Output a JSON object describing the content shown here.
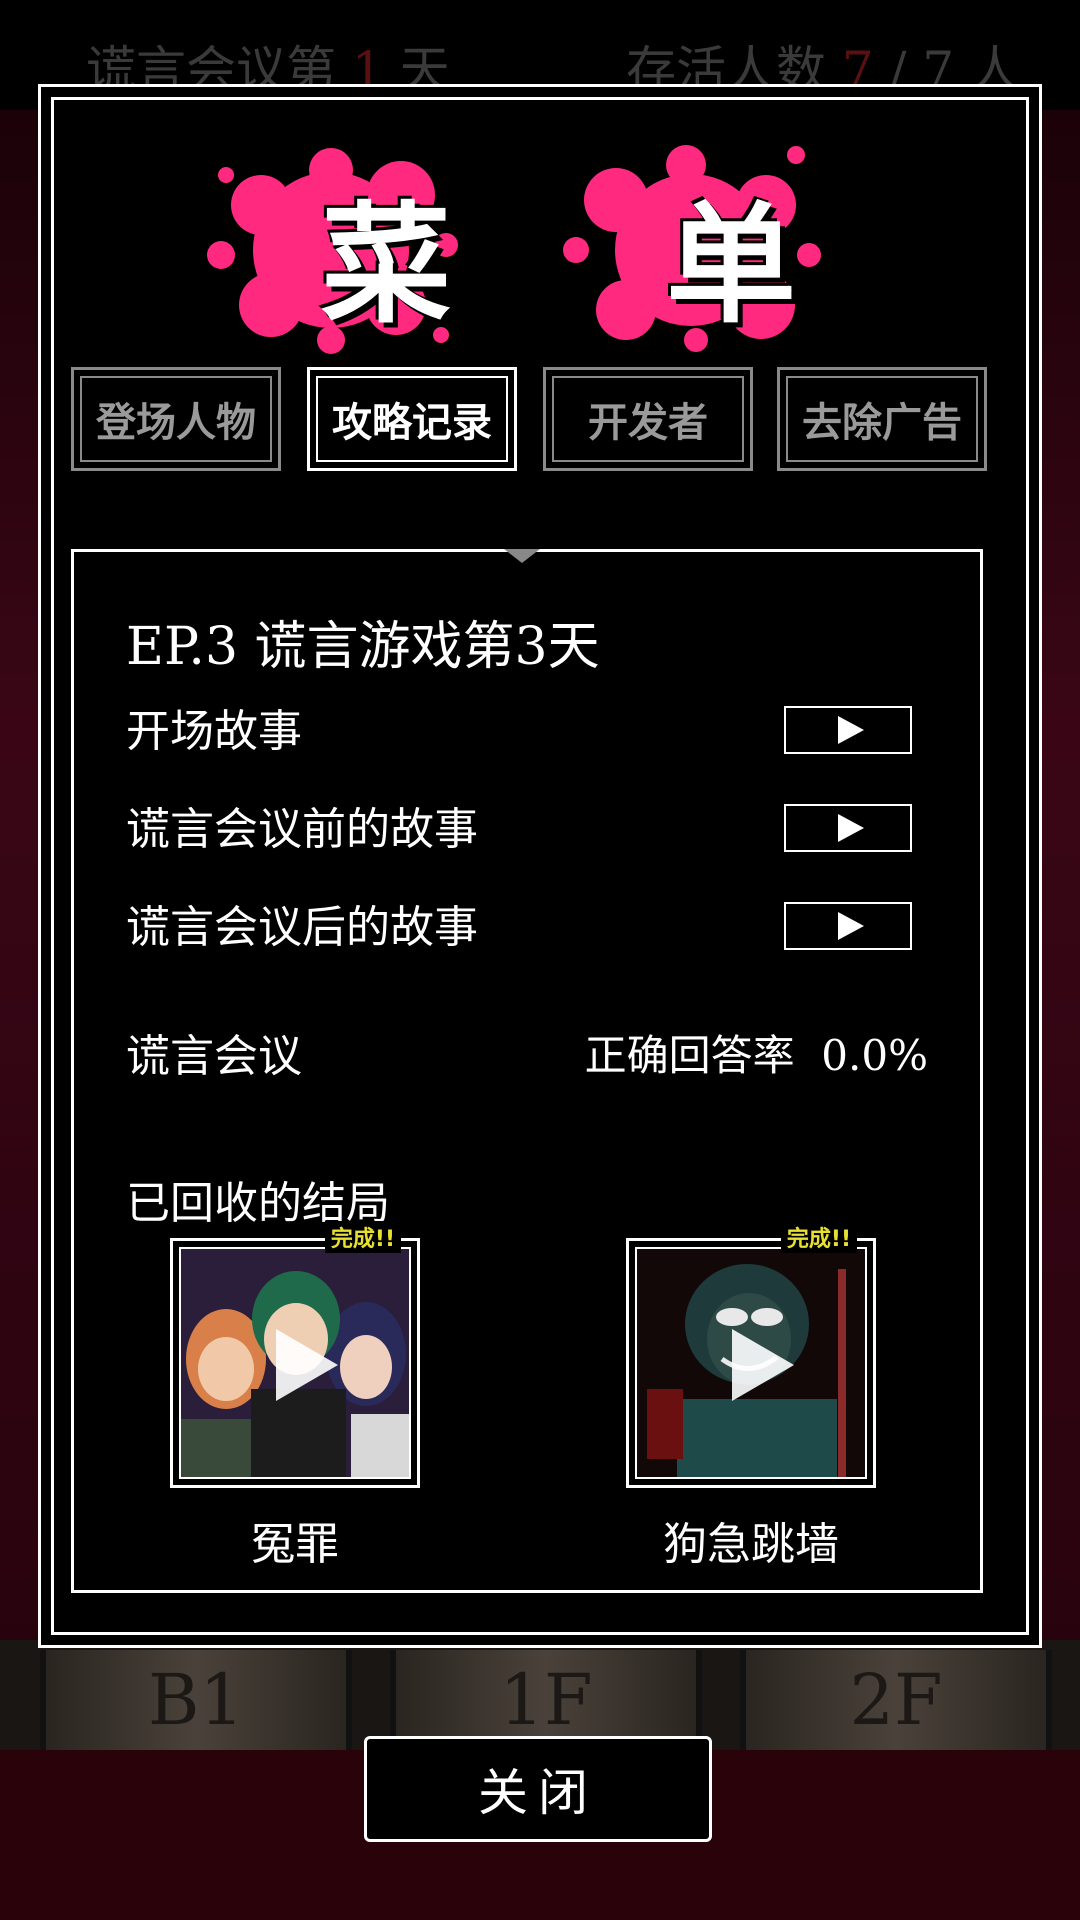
{
  "background": {
    "meeting_day": "谎言会议第",
    "day_number": "1",
    "day_unit": "天",
    "survivors_label": "存活人数",
    "survivors_current": "7",
    "survivors_sep": "/",
    "survivors_total": "7",
    "survivors_unit": "人",
    "floors": [
      "B1",
      "1F",
      "2F"
    ]
  },
  "menu": {
    "title_chars": [
      "菜",
      "单"
    ],
    "splat_color": "#ff2a7f",
    "tabs": [
      {
        "label": "登场人物",
        "active": false
      },
      {
        "label": "攻略记录",
        "active": true
      },
      {
        "label": "开发者",
        "active": false
      },
      {
        "label": "去除广告",
        "active": false
      }
    ]
  },
  "record": {
    "episode_title": "EP.3  谎言游戏第3天",
    "stories": [
      {
        "label": "开场故事"
      },
      {
        "label": "谎言会议前的故事"
      },
      {
        "label": "谎言会议后的故事"
      }
    ],
    "meeting_label": "谎言会议",
    "accuracy_label": "正确回答率",
    "accuracy_value": "0.0%",
    "endings_heading": "已回收的结局",
    "endings": [
      {
        "name": "冤罪",
        "badge": "完成!!"
      },
      {
        "name": "狗急跳墙",
        "badge": "完成!!"
      }
    ]
  },
  "close_label": "关闭"
}
